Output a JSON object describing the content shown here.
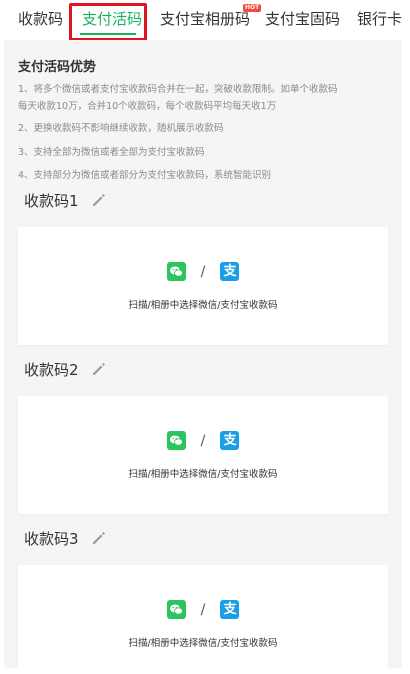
{
  "tabs": [
    {
      "label": "收款码"
    },
    {
      "label": "支付活码"
    },
    {
      "label": "支付宝相册码"
    },
    {
      "label": "支付宝固码"
    },
    {
      "label": "银行卡"
    }
  ],
  "hot_badge": "HOT",
  "advantages": {
    "title": "支付活码优势",
    "lines": [
      "1、将多个微信或者支付宝收款码合并在一起，突破收款限制。如单个收款码",
      "每天收款10万，合并10个收款码，每个收款码平均每天收1万",
      "2、更换收款码不影响继续收款，随机展示收款码",
      "3、支持全部为微信或者全部为支付宝收款码",
      "4、支持部分为微信或者部分为支付宝收款码，系统智能识别"
    ]
  },
  "codes": [
    {
      "title": "收款码1",
      "slash": "/",
      "alipay_char": "支",
      "hint": "扫描/相册中选择微信/支付宝收款码"
    },
    {
      "title": "收款码2",
      "slash": "/",
      "alipay_char": "支",
      "hint": "扫描/相册中选择微信/支付宝收款码"
    },
    {
      "title": "收款码3",
      "slash": "/",
      "alipay_char": "支",
      "hint": "扫描/相册中选择微信/支付宝收款码"
    }
  ],
  "colors": {
    "accent": "#17b35c",
    "highlight": "#e0141e",
    "wechat": "#2cc45f",
    "alipay": "#1a9fe4"
  }
}
